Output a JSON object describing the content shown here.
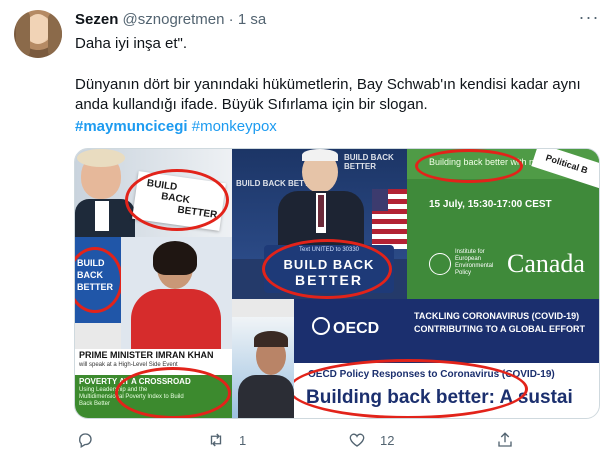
{
  "tweet": {
    "author_name": "Sezen",
    "author_handle": "@sznogretmen",
    "separator": "·",
    "time": "1 sa",
    "more_label": "···",
    "quote": "Daha iyi inşa et\".",
    "body_line1": "Dünyanın dört bir yanındaki hükümetlerin, Bay Schwab'ın kendisi kadar aynı",
    "body_line2": "anda kullandığı ifade. Büyük Sıfırlama için bir slogan.",
    "hashtag1": "#maymuncicegi",
    "hashtag2": "#monkeypox"
  },
  "media": {
    "sign_bbb": "BUILD BACK BETTER",
    "sign_build": "BUILD",
    "sign_back": "BACK",
    "sign_better": "BETTER",
    "podium_small": "Text UNITED to 30330",
    "podium_build_back": "BUILD BACK",
    "podium_better": "BETTER",
    "webinar_title": "Building back better with nature",
    "webinar_tag": "Political B",
    "webinar_date": "15 July, 15:30-17:00 CEST",
    "institute": "Institute for European Environmental Policy",
    "canada": "Canada",
    "pm_title": "PRIME MINISTER IMRAN KHAN",
    "pm_sub": "will speak at a High-Level Side Event",
    "poverty_title": "POVERTY AT A CROSSROAD",
    "poverty_sub": "Using Leadership and the Multidimensional Poverty Index to Build Back Better",
    "oecd": "OECD",
    "tackling1": "TACKLING CORONAVIRUS (COVID-19)",
    "tackling2": "CONTRIBUTING TO A GLOBAL EFFORT",
    "oecd_policy": "OECD Policy Responses to Coronavirus (COVID-19)",
    "oecd_headline": "Building back better: A sustai"
  },
  "actions": {
    "reply_count": "",
    "retweet_count": "1",
    "like_count": "12"
  },
  "colors": {
    "link": "#1d9bf0",
    "muted": "#536471",
    "highlight": "#e2231a"
  }
}
